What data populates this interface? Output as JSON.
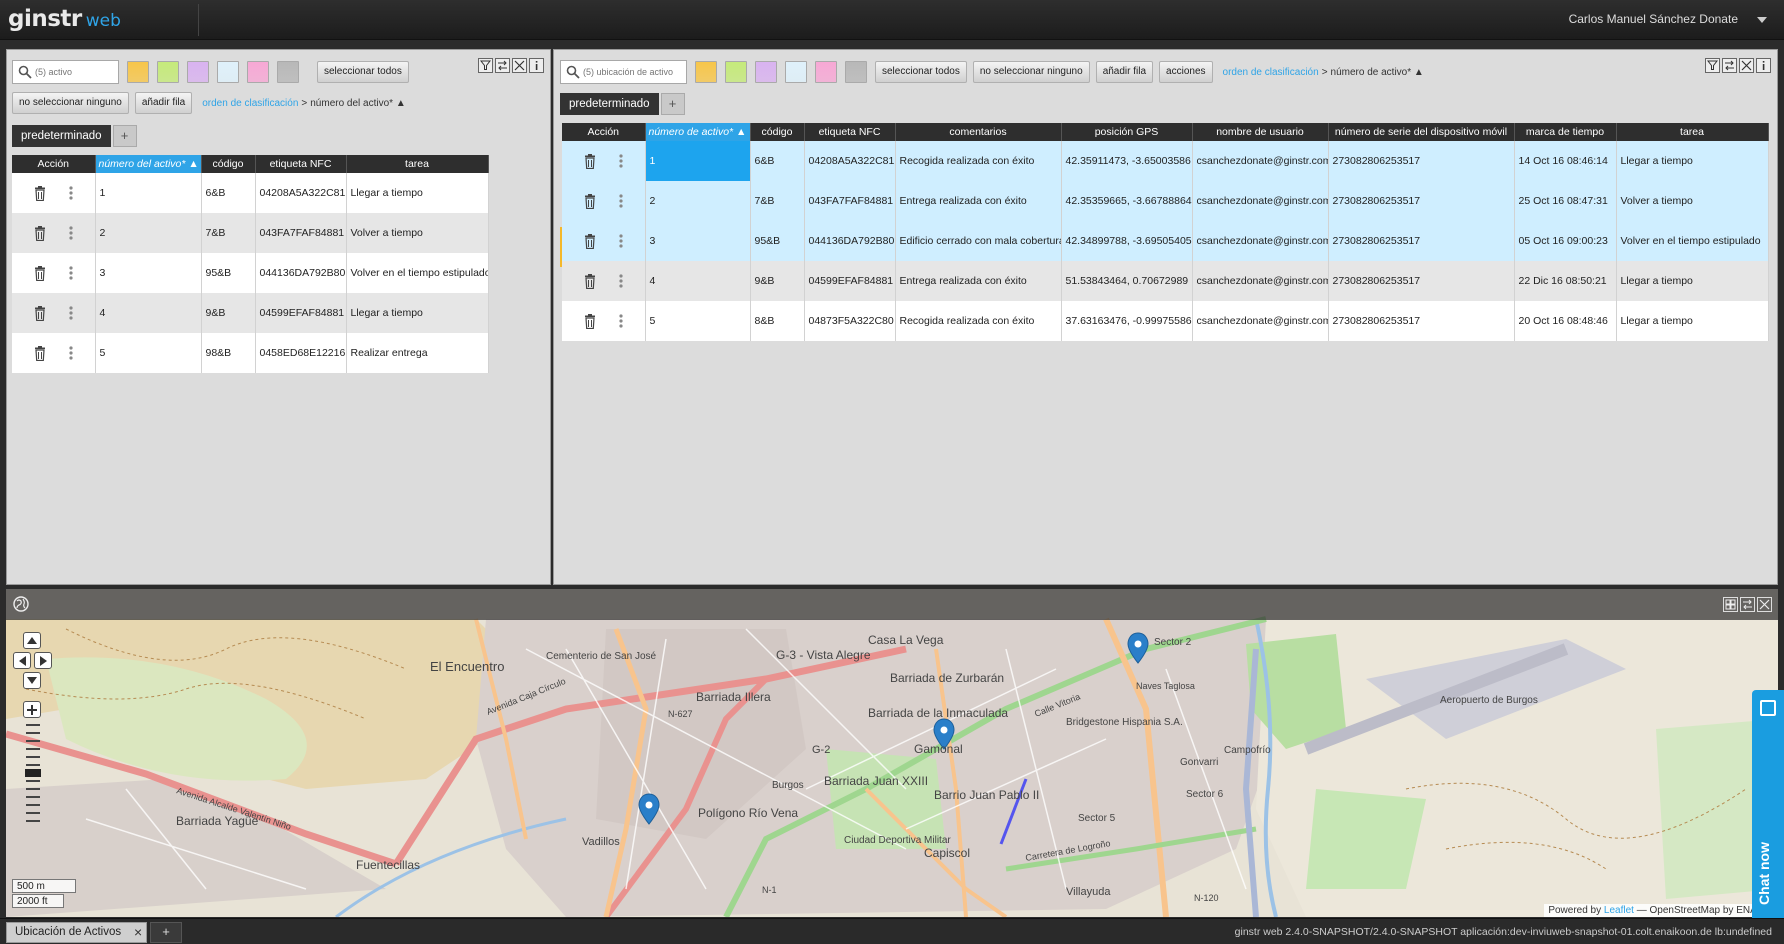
{
  "header": {
    "logo_main": "ginstr",
    "logo_sub": "web",
    "user_name": "Carlos Manuel Sánchez Donate"
  },
  "colors": {
    "accent": "#2fa4e7",
    "selected_row": "#cfeeff",
    "selected_cell": "#1da4ee",
    "swatch_colors": [
      "#f7c64a",
      "#c5ea7a",
      "#d9b3f0",
      "#dff1fb",
      "#f7a8d5",
      "#b8b8b8"
    ]
  },
  "left_panel": {
    "search_placeholder": "(5) activo",
    "buttons": {
      "select_all": "seleccionar todos",
      "select_none": "no seleccionar ninguno",
      "add_row": "añadir fila"
    },
    "sort": {
      "label": "orden de clasificación",
      "separator": ">",
      "value": "número del activo* ▲"
    },
    "tab": "predeterminado",
    "tab_add": "+",
    "columns": [
      "Acción",
      "número del activo* ▲",
      "código",
      "etiqueta NFC",
      "tarea"
    ],
    "rows": [
      {
        "num": "1",
        "code": "6&B",
        "nfc": "04208A5A322C81",
        "task": "Llegar a tiempo"
      },
      {
        "num": "2",
        "code": "7&B",
        "nfc": "043FA7FAF84881",
        "task": "Volver a tiempo"
      },
      {
        "num": "3",
        "code": "95&B",
        "nfc": "044136DA792B80",
        "task": "Volver en el tiempo estipulado"
      },
      {
        "num": "4",
        "code": "9&B",
        "nfc": "04599EFAF84881",
        "task": "Llegar a tiempo"
      },
      {
        "num": "5",
        "code": "98&B",
        "nfc": "0458ED68E12216",
        "task": "Realizar entrega"
      }
    ]
  },
  "right_panel": {
    "search_placeholder": "(5) ubicación de activo",
    "buttons": {
      "select_all": "seleccionar todos",
      "select_none": "no seleccionar ninguno",
      "add_row": "añadir fila",
      "actions": "acciones"
    },
    "sort": {
      "label": "orden de clasificación",
      "separator": ">",
      "value": "número de activo* ▲"
    },
    "tab": "predeterminado",
    "tab_add": "+",
    "columns": [
      "Acción",
      "número de activo* ▲",
      "código",
      "etiqueta NFC",
      "comentarios",
      "posición GPS",
      "nombre de usuario",
      "número de serie del dispositivo móvil",
      "marca de tiempo",
      "tarea"
    ],
    "rows": [
      {
        "num": "1",
        "code": "6&B",
        "nfc": "04208A5A322C81",
        "comment": "Recogida realizada con éxito",
        "gps": "42.35911473, -3.65003586",
        "user": "csanchezdonate@ginstr.com",
        "serial": "273082806253517",
        "time": "14 Oct 16 08:46:14",
        "task": "Llegar a tiempo",
        "selected": true
      },
      {
        "num": "2",
        "code": "7&B",
        "nfc": "043FA7FAF84881",
        "comment": "Entrega realizada con éxito",
        "gps": "42.35359665, -3.66788864",
        "user": "csanchezdonate@ginstr.com",
        "serial": "273082806253517",
        "time": "25 Oct 16 08:47:31",
        "task": "Volver a tiempo",
        "selected": true
      },
      {
        "num": "3",
        "code": "95&B",
        "nfc": "044136DA792B80",
        "comment": "Edificio cerrado con mala cobertura",
        "gps": "42.34899788, -3.69505405",
        "user": "csanchezdonate@ginstr.com",
        "serial": "273082806253517",
        "time": "05 Oct 16 09:00:23",
        "task": "Volver en el tiempo estipulado",
        "selected": true
      },
      {
        "num": "4",
        "code": "9&B",
        "nfc": "04599EFAF84881",
        "comment": "Entrega realizada con éxito",
        "gps": "51.53843464, 0.70672989",
        "user": "csanchezdonate@ginstr.com",
        "serial": "273082806253517",
        "time": "22 Dic 16 08:50:21",
        "task": "Llegar a tiempo",
        "selected": false
      },
      {
        "num": "5",
        "code": "8&B",
        "nfc": "04873F5A322C80",
        "comment": "Recogida realizada con éxito",
        "gps": "37.63163476, -0.99975586",
        "user": "csanchezdonate@ginstr.com",
        "serial": "273082806253517",
        "time": "20 Oct 16 08:48:46",
        "task": "Llegar a tiempo",
        "selected": false
      }
    ]
  },
  "map": {
    "labels": [
      "El Encuentro",
      "Cementerio de San José",
      "G-3 - Vista Alegre",
      "Casa La Vega",
      "Barriada de Zurbarán",
      "Barriada Illera",
      "Barriada de la Inmaculada",
      "Gamonal",
      "Barriada Juan XXIII",
      "Barrio Juan Pablo II",
      "Polígono Río Vena",
      "Burgos",
      "Vadillos",
      "Capiscol",
      "Ciudad Deportiva Militar",
      "Barriada Yagüe",
      "Fuentecillas",
      "Villayuda",
      "Gonvarri",
      "Campofrío",
      "Bridgestone Hispania S.A.",
      "Aeropuerto de Burgos",
      "Sector 6",
      "Sector 5",
      "Sector 2",
      "Naves Taglosa",
      "Avenida Caja Círculo",
      "Avenida Alcalde Valentín Niño",
      "Calle Vitoria",
      "Carretera de Logroño",
      "N-627",
      "N-120",
      "N-1",
      "G-2"
    ],
    "scale_metric": "500 m",
    "scale_imperial": "2000 ft",
    "attribution_prefix": "Powered by",
    "attribution_link": "Leaflet",
    "attribution_suffix": "— OpenStreetMap by ENAIKO"
  },
  "chat": {
    "label": "Chat now"
  },
  "footer": {
    "tab_label": "Ubicación de Activos",
    "tab_close": "×",
    "tab_add": "+",
    "version": "ginstr web 2.4.0-SNAPSHOT/2.4.0-SNAPSHOT aplicación:dev-inviuweb-snapshot-01.colt.enaikoon.de lb:undefined"
  }
}
